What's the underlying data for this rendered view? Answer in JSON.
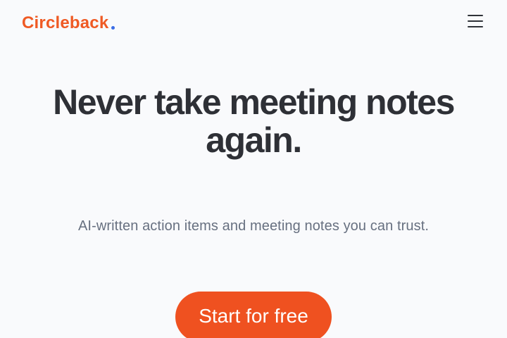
{
  "header": {
    "logo_text": "Circleback",
    "logo_color": "#ef5a24",
    "logo_dot_color": "#3b6de6",
    "menu_icon": "hamburger-menu-icon"
  },
  "hero": {
    "headline": "Never take meeting notes again.",
    "subheadline": "AI-written action items and meeting notes you can trust.",
    "cta_label": "Start for free",
    "cta_color": "#ef5120"
  }
}
